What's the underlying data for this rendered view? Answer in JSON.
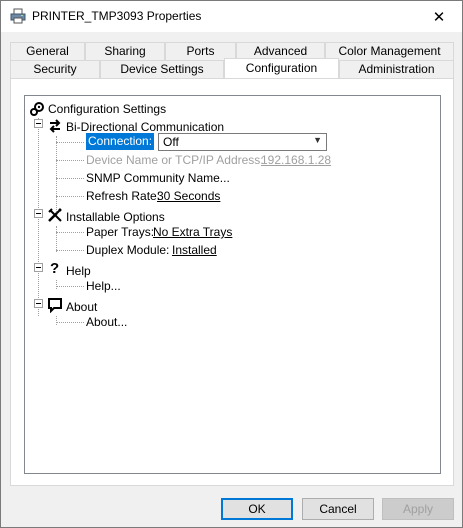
{
  "window": {
    "title": "PRINTER_TMP3093 Properties",
    "close_glyph": "✕"
  },
  "tabs": {
    "row1": [
      "General",
      "Sharing",
      "Ports",
      "Advanced",
      "Color Management"
    ],
    "row2": [
      "Security",
      "Device Settings",
      "Configuration",
      "Administration"
    ],
    "active": "Configuration"
  },
  "tree": {
    "root": "Configuration Settings",
    "bidi": {
      "label": "Bi-Directional Communication",
      "connection_label": "Connection:",
      "connection_value": "Off",
      "device_label": "Device Name or TCP/IP Address:",
      "device_value": "192.168.1.28",
      "snmp_label": "SNMP Community Name...",
      "refresh_label": "Refresh Rate:",
      "refresh_value": "30 Seconds"
    },
    "options": {
      "label": "Installable Options",
      "trays_label": "Paper Trays:",
      "trays_value": "No Extra Trays",
      "duplex_label": "Duplex Module:",
      "duplex_value": "Installed"
    },
    "help": {
      "label": "Help",
      "item": "Help..."
    },
    "about": {
      "label": "About",
      "item": "About..."
    }
  },
  "buttons": {
    "ok": "OK",
    "cancel": "Cancel",
    "apply": "Apply"
  }
}
